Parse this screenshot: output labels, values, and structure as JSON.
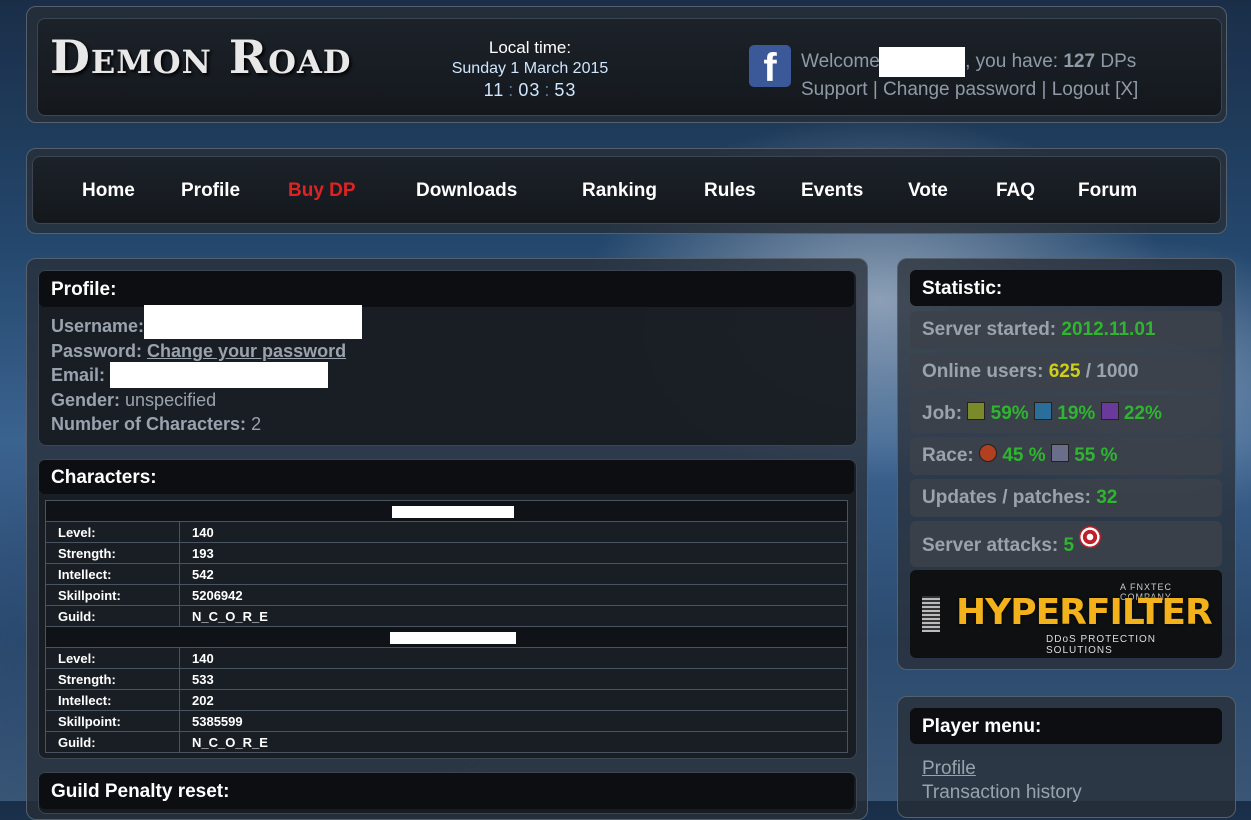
{
  "header": {
    "logo": "Demon Road",
    "local_time_label": "Local time:",
    "date": "Sunday 1 March 2015",
    "time": {
      "h": "11",
      "m": "03",
      "s": "53"
    },
    "welcome_prefix": "Welcome",
    "welcome_mid": ", you have:",
    "dp_count": "127",
    "dp_unit": "DPs",
    "links": {
      "support": "Support",
      "change_password": "Change password",
      "logout": "Logout [X]"
    },
    "sep": "|"
  },
  "nav": [
    "Home",
    "Profile",
    "Buy DP",
    "Downloads",
    "Ranking",
    "Rules",
    "Events",
    "Vote",
    "FAQ",
    "Forum"
  ],
  "profile": {
    "title": "Profile:",
    "username_label": "Username:",
    "password_label": "Password:",
    "password_link": "Change your password",
    "email_label": "Email:",
    "gender_label": "Gender:",
    "gender_value": "unspecified",
    "num_chars_label": "Number of Characters:",
    "num_chars_value": "2"
  },
  "characters": {
    "title": "Characters:",
    "list": [
      {
        "rows": [
          [
            "Level:",
            "140"
          ],
          [
            "Strength:",
            "193"
          ],
          [
            "Intellect:",
            "542"
          ],
          [
            "Skillpoint:",
            "5206942"
          ],
          [
            "Guild:",
            "N_C_O_R_E"
          ]
        ]
      },
      {
        "rows": [
          [
            "Level:",
            "140"
          ],
          [
            "Strength:",
            "533"
          ],
          [
            "Intellect:",
            "202"
          ],
          [
            "Skillpoint:",
            "5385599"
          ],
          [
            "Guild:",
            "N_C_O_R_E"
          ]
        ]
      }
    ]
  },
  "guild_penalty": {
    "title": "Guild Penalty reset:"
  },
  "statistic": {
    "title": "Statistic:",
    "server_started_label": "Server started:",
    "server_started": "2012.11.01",
    "online_label": "Online users:",
    "online": "625",
    "online_sep": "/",
    "online_max": "1000",
    "job_label": "Job:",
    "job": [
      "59%",
      "19%",
      "22%"
    ],
    "race_label": "Race:",
    "race": [
      "45 %",
      "55 %"
    ],
    "updates_label": "Updates / patches:",
    "updates": "32",
    "attacks_label": "Server attacks:",
    "attacks": "5",
    "banner": {
      "company": "A FNXTEC COMPANY",
      "name": "HYPERFILTER",
      "tagline": "DDoS PROTECTION SOLUTIONS"
    }
  },
  "player_menu": {
    "title": "Player menu:",
    "items": [
      "Profile",
      "Transaction history"
    ]
  },
  "colors": {
    "accent_red": "#e02222",
    "value_green": "#2fb52f",
    "value_yellow": "#cfcf1a",
    "facebook": "#3b5998"
  }
}
